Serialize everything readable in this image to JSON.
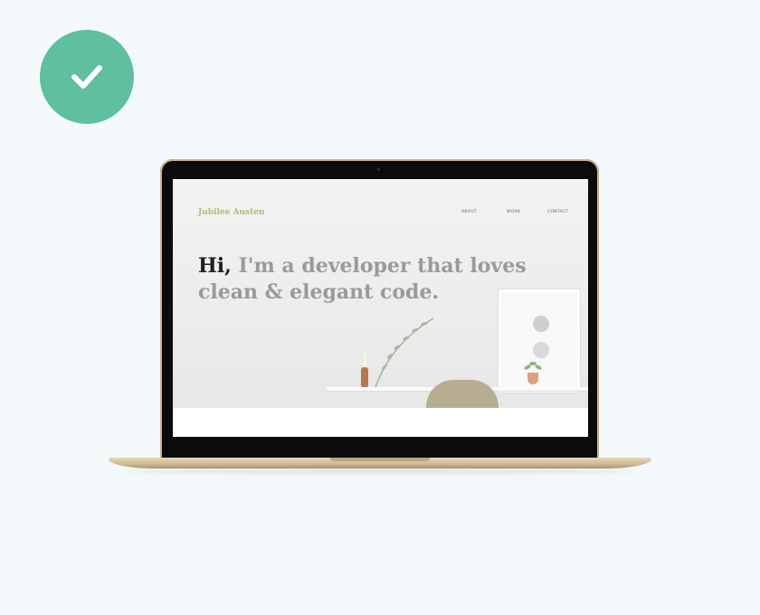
{
  "badge": {
    "icon": "check-icon",
    "color": "#5fbf9f"
  },
  "website": {
    "site_name": "Jubilee Austen",
    "nav": [
      "ABOUT",
      "WORK",
      "CONTACT"
    ],
    "headline_hi": "Hi,",
    "headline_rest": " I'm a developer that loves clean & elegant code."
  },
  "colors": {
    "background": "#f3f9fa",
    "accent_green": "#a8bf72",
    "laptop_gold": "#cdb894"
  }
}
